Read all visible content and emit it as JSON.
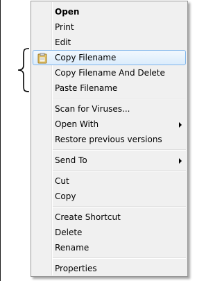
{
  "menu": {
    "items": [
      {
        "label": "Open"
      },
      {
        "label": "Print"
      },
      {
        "label": "Edit"
      },
      {
        "label": "Copy Filename",
        "icon": "clipboard-icon",
        "hovered": true
      },
      {
        "label": "Copy Filename And Delete"
      },
      {
        "label": "Paste Filename"
      },
      {
        "label": "Scan for Viruses..."
      },
      {
        "label": "Open With",
        "submenu": true
      },
      {
        "label": "Restore previous versions"
      },
      {
        "label": "Send To",
        "submenu": true
      },
      {
        "label": "Cut"
      },
      {
        "label": "Copy"
      },
      {
        "label": "Create Shortcut"
      },
      {
        "label": "Delete"
      },
      {
        "label": "Rename"
      },
      {
        "label": "Properties"
      }
    ]
  },
  "colors": {
    "menu_bg": "#f0f0f0",
    "hover_border": "#7eb4ea",
    "hover_fill": "#dbecfc",
    "clipboard_icon": "#e8c66a"
  }
}
